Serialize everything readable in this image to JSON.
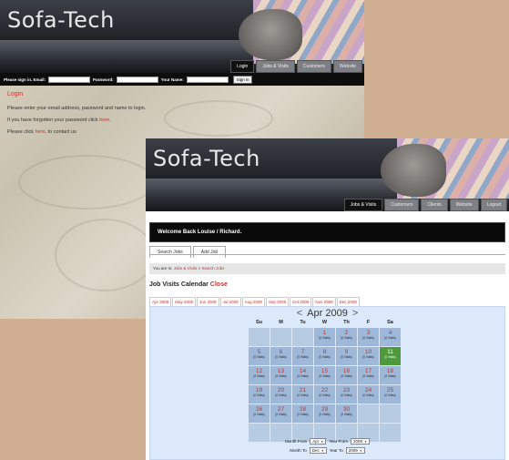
{
  "login_page": {
    "logo": "Sofa-Tech",
    "nav": [
      "Login",
      "Jobs & Visits",
      "Customers",
      "Website"
    ],
    "signin": {
      "email_label": "Please sign in. Email:",
      "password_label": "Password:",
      "name_label": "Your Name:",
      "button": "Sign in"
    },
    "heading": "Login",
    "line1": "Please enter your email address, password and name to login.",
    "line2_prefix": "If you have forgotten your password click ",
    "line2_link": "here",
    "line2_suffix": ".",
    "line3_prefix": "Please click ",
    "line3_link": "here",
    "line3_suffix": ", to contact us"
  },
  "app": {
    "logo": "Sofa-Tech",
    "nav": [
      "Jobs & Visits",
      "Customers",
      "Clients",
      "Website",
      "Logout"
    ],
    "welcome": "Welcome Back Louise / Richard.",
    "subtabs": [
      "Search Jobs",
      "Add Job"
    ],
    "breadcrumb_prefix": "You are in: ",
    "breadcrumb_link1": "Jobs & Visits",
    "breadcrumb_sep": " > ",
    "breadcrumb_link2": "Search Jobs",
    "title": "Job Visits Calendar",
    "title_close": "Close",
    "months": [
      "Apr 2009",
      "May 2009",
      "Jun 2009",
      "Jul 2009",
      "Aug 2009",
      "Sep 2009",
      "Oct 2009",
      "Nov 2009",
      "Dec 2009"
    ],
    "calendar": {
      "prev": "<",
      "next": ">",
      "month_label": "Apr 2009",
      "dow": [
        "Su",
        "M",
        "Tu",
        "W",
        "Th",
        "F",
        "Sa"
      ],
      "visits_label": "(0 Visits)",
      "today": "11",
      "weeks": [
        [
          "",
          "",
          "",
          "1",
          "2",
          "3",
          "4"
        ],
        [
          "5",
          "6",
          "7",
          "8",
          "9",
          "10",
          "11"
        ],
        [
          "12",
          "13",
          "14",
          "15",
          "16",
          "17",
          "18"
        ],
        [
          "19",
          "20",
          "21",
          "22",
          "23",
          "24",
          "25"
        ],
        [
          "26",
          "27",
          "28",
          "29",
          "30",
          "",
          ""
        ],
        [
          "",
          "",
          "",
          "",
          "",
          "",
          ""
        ]
      ]
    },
    "range": {
      "month_from_label": "Month From",
      "month_from": "Apr",
      "year_from_label": "Year From",
      "year_from": "2009",
      "month_to_label": "Month To",
      "month_to": "Dec",
      "year_to_label": "Year To",
      "year_to": "2009"
    }
  },
  "colors": {
    "accent_red": "#c0362c",
    "calendar_bg": "#dbe9fb",
    "day_cell": "#9db8d8",
    "today_cell": "#4e9a3a"
  }
}
